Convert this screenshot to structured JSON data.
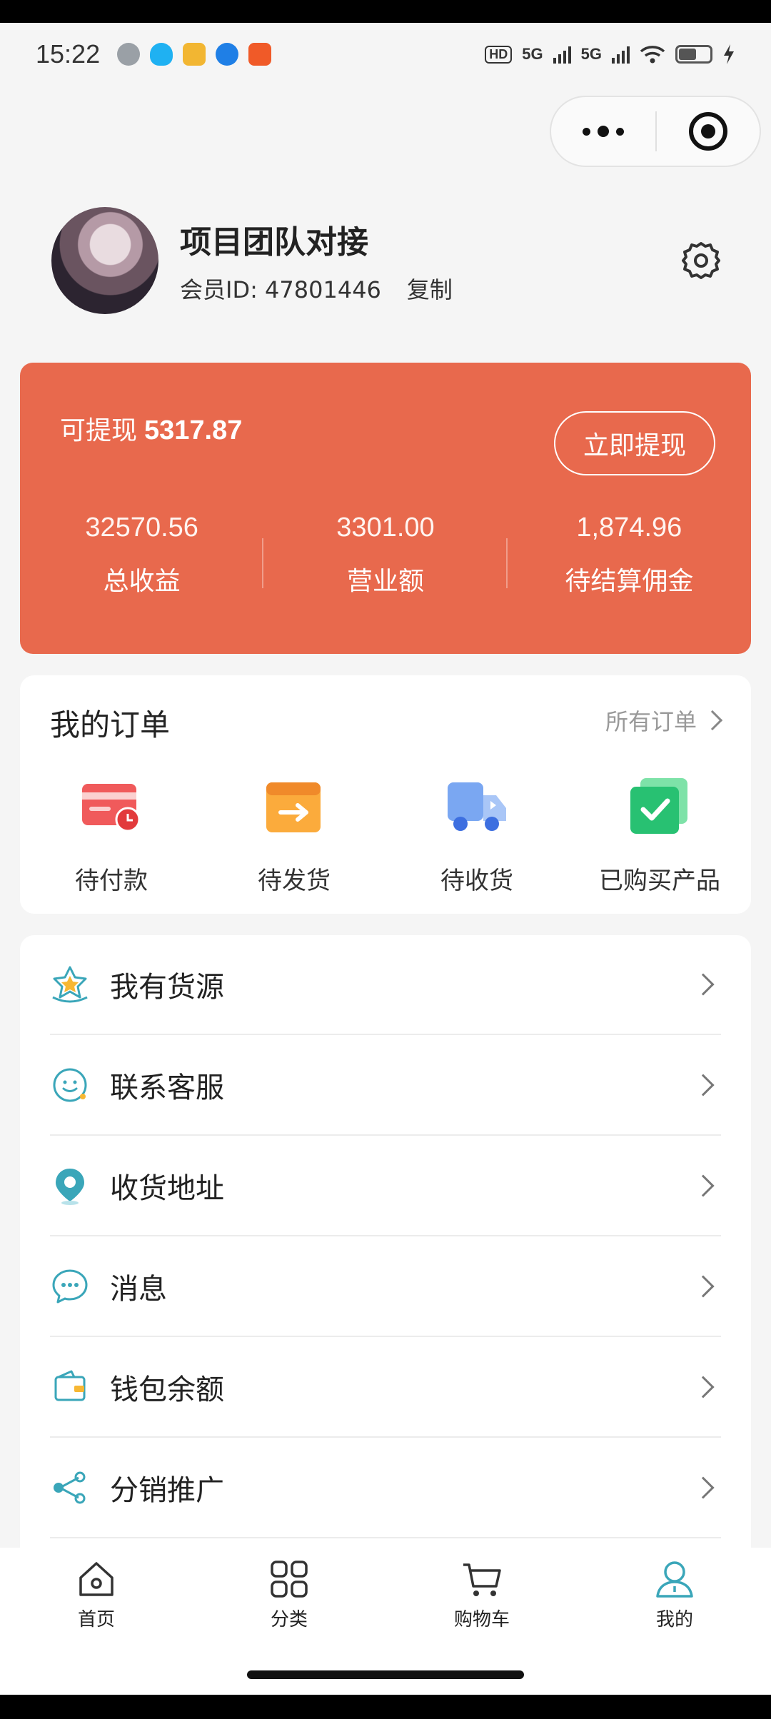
{
  "status_bar": {
    "time": "15:22",
    "hd": "HD",
    "net1": "5G",
    "net2": "5G"
  },
  "profile": {
    "name": "项目团队对接",
    "member_id": "会员ID: 47801446",
    "copy_label": "复制"
  },
  "earnings": {
    "withdrawable_label": "可提现",
    "withdrawable_amount": "5317.87",
    "withdraw_button": "立即提现",
    "stats": [
      {
        "value": "32570.56",
        "label": "总收益"
      },
      {
        "value": "3301.00",
        "label": "营业额"
      },
      {
        "value": "1,874.96",
        "label": "待结算佣金"
      }
    ],
    "color": "#e8694d"
  },
  "orders": {
    "title": "我的订单",
    "all_link": "所有订单",
    "items": [
      {
        "label": "待付款",
        "icon": "wallet-card-icon"
      },
      {
        "label": "待发货",
        "icon": "ship-box-icon"
      },
      {
        "label": "待收货",
        "icon": "delivery-truck-icon"
      },
      {
        "label": "已购买产品",
        "icon": "check-square-icon"
      }
    ]
  },
  "menu": {
    "items": [
      {
        "label": "我有货源",
        "icon": "star-badge-icon"
      },
      {
        "label": "联系客服",
        "icon": "customer-service-icon"
      },
      {
        "label": "收货地址",
        "icon": "location-pin-icon"
      },
      {
        "label": "消息",
        "icon": "chat-bubble-icon"
      },
      {
        "label": "钱包余额",
        "icon": "wallet-icon"
      },
      {
        "label": "分销推广",
        "icon": "share-icon"
      }
    ]
  },
  "tabbar": {
    "items": [
      {
        "label": "首页",
        "icon": "home-icon"
      },
      {
        "label": "分类",
        "icon": "grid-icon"
      },
      {
        "label": "购物车",
        "icon": "cart-icon"
      },
      {
        "label": "我的",
        "icon": "user-icon",
        "active": true
      }
    ],
    "accent": "#3aa6b9"
  }
}
